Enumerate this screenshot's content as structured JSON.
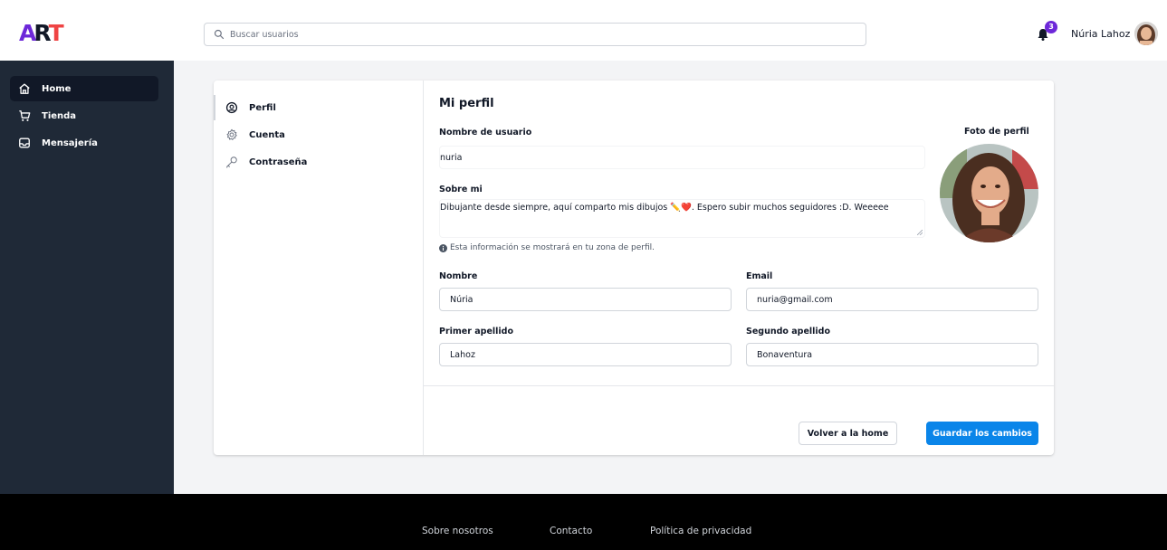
{
  "header": {
    "logo_text": "ART",
    "search_placeholder": "Buscar usuarios",
    "notification_count": "3",
    "user_name": "Núria Lahoz"
  },
  "sidebar": {
    "items": [
      {
        "label": "Home",
        "icon": "home-icon",
        "active": true
      },
      {
        "label": "Tienda",
        "icon": "cart-icon",
        "active": false
      },
      {
        "label": "Mensajería",
        "icon": "inbox-icon",
        "active": false
      }
    ]
  },
  "settings_nav": {
    "items": [
      {
        "label": "Perfil",
        "icon": "user-circle-icon",
        "active": true
      },
      {
        "label": "Cuenta",
        "icon": "gear-icon",
        "active": false
      },
      {
        "label": "Contraseña",
        "icon": "key-icon",
        "active": false
      }
    ]
  },
  "profile_form": {
    "title": "Mi perfil",
    "username_label": "Nombre de usuario",
    "username_value": "nuria",
    "about_label": "Sobre mi",
    "about_value": "Dibujante desde siempre, aquí comparto mis dibujos ✏️❤️. Espero subir muchos seguidores :D. Weeeee",
    "about_hint": "Esta información se mostrará en tu zona de perfil.",
    "photo_label": "Foto de perfil",
    "first_name_label": "Nombre",
    "first_name_value": "Núria",
    "email_label": "Email",
    "email_value": "nuria@gmail.com",
    "last_name1_label": "Primer apellido",
    "last_name1_value": "Lahoz",
    "last_name2_label": "Segundo apellido",
    "last_name2_value": "Bonaventura",
    "back_button": "Volver a la home",
    "save_button": "Guardar los cambios"
  },
  "footer": {
    "links": [
      "Sobre nosotros",
      "Contacto",
      "Política de privacidad"
    ]
  },
  "colors": {
    "brand_purple": "#6d28d9",
    "primary_button": "#0a85e9",
    "sidebar_bg": "#1f2937",
    "footer_bg": "#000000"
  }
}
